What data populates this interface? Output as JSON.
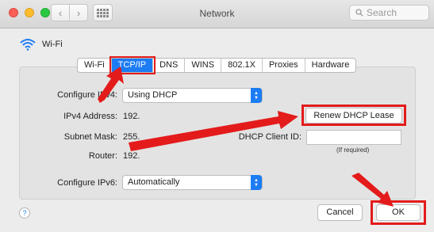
{
  "window": {
    "title": "Network"
  },
  "search": {
    "placeholder": "Search"
  },
  "interface": {
    "name": "Wi-Fi"
  },
  "tabs": [
    {
      "label": "Wi-Fi",
      "active": false
    },
    {
      "label": "TCP/IP",
      "active": true
    },
    {
      "label": "DNS",
      "active": false
    },
    {
      "label": "WINS",
      "active": false
    },
    {
      "label": "802.1X",
      "active": false
    },
    {
      "label": "Proxies",
      "active": false
    },
    {
      "label": "Hardware",
      "active": false
    }
  ],
  "form": {
    "configure_ipv4_label": "Configure IPv4:",
    "configure_ipv4_value": "Using DHCP",
    "ipv4_address_label": "IPv4 Address:",
    "ipv4_address_value": "192.",
    "subnet_mask_label": "Subnet Mask:",
    "subnet_mask_value": "255.",
    "router_label": "Router:",
    "router_value": "192.",
    "renew_button": "Renew DHCP Lease",
    "dhcp_client_id_label": "DHCP Client ID:",
    "dhcp_client_id_value": "",
    "dhcp_client_id_hint": "(If required)",
    "configure_ipv6_label": "Configure IPv6:",
    "configure_ipv6_value": "Automatically"
  },
  "footer": {
    "help": "?",
    "cancel": "Cancel",
    "ok": "OK"
  },
  "colors": {
    "accent": "#1c7cf4",
    "annotation": "#e41b1b"
  }
}
